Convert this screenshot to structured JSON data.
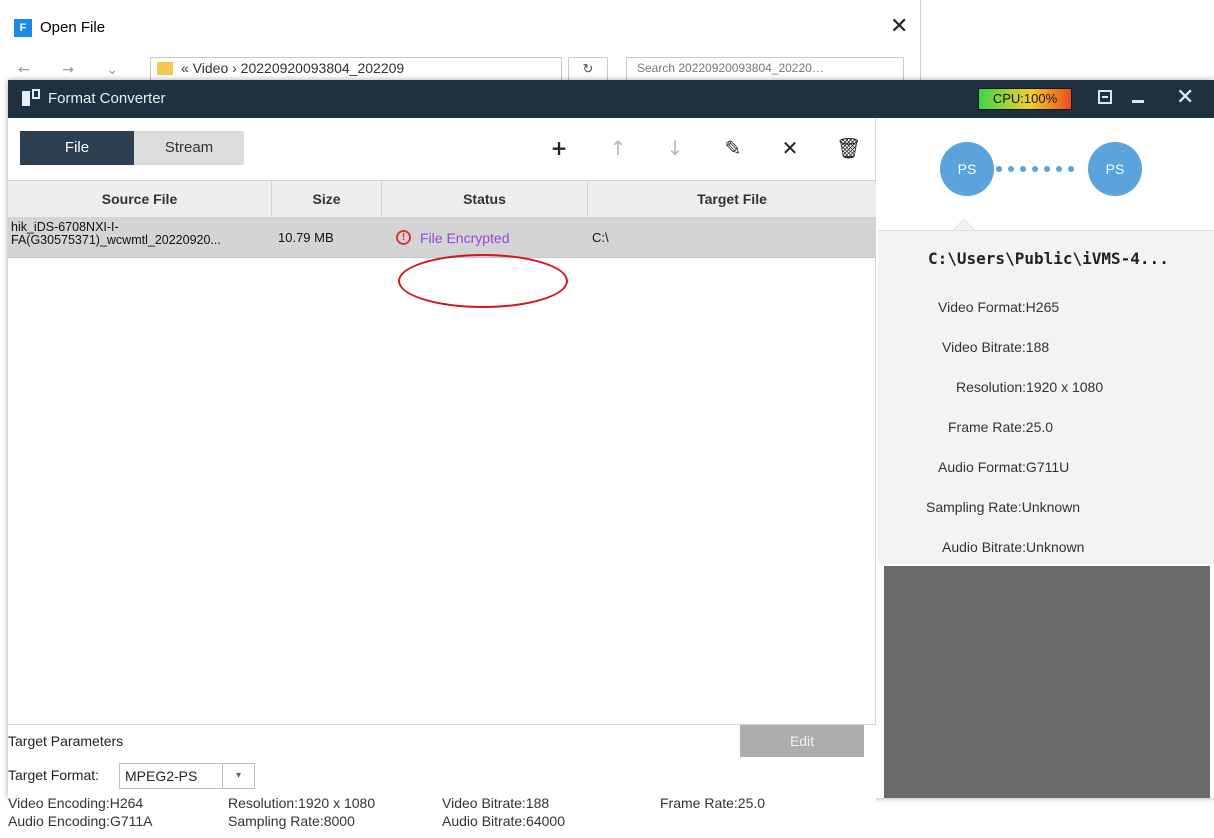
{
  "open_dialog": {
    "title": "Open File",
    "close_glyph": "✕",
    "nav_glyphs": "← → ⌄ ↑",
    "address": "« Video › 20220920093804_202209",
    "search_placeholder": "Search 20220920093804_20220…",
    "refresh_glyph": "↻"
  },
  "window": {
    "title": "Format Converter",
    "cpu_label": "CPU:100%",
    "close_glyph": "✕"
  },
  "tabs": {
    "file": "File",
    "stream": "Stream"
  },
  "toolbar": {
    "add_icon": "+",
    "up_icon": "↑",
    "down_icon": "↓",
    "edit_icon": "✎",
    "remove_icon": "✕",
    "delete_icon": "🗑"
  },
  "table": {
    "columns": [
      "Source File",
      "Size",
      "Status",
      "Target File"
    ],
    "rows": [
      {
        "source_line1": "hik_iDS-6708NXI-I-",
        "source_line2": "FA(G30575371)_wcwmtl_20220920...",
        "size": "10.79 MB",
        "status_icon": "!",
        "status": "File Encrypted",
        "target": "C:\\"
      }
    ]
  },
  "params": {
    "title": "Target Parameters",
    "edit_label": "Edit",
    "target_format_label": "Target Format:",
    "target_format_value": "MPEG2-PS",
    "caret": "▾",
    "video_encoding": "Video Encoding:H264",
    "resolution": "Resolution:1920 x 1080",
    "video_bitrate": "Video Bitrate:188",
    "frame_rate": "Frame Rate:25.0",
    "audio_encoding": "Audio Encoding:G711A",
    "sampling_rate": "Sampling Rate:8000",
    "audio_bitrate": "Audio Bitrate:64000"
  },
  "info": {
    "src_label": "PS",
    "dst_label": "PS",
    "path": "C:\\Users\\Public\\iVMS-4...",
    "video_format": "Video Format:H265",
    "video_bitrate": "Video Bitrate:188",
    "resolution": "Resolution:1920 x 1080",
    "frame_rate": "Frame Rate:25.0",
    "audio_format": "Audio Format:G711U",
    "sampling_rate": "Sampling Rate:Unknown",
    "audio_bitrate": "Audio Bitrate:Unknown"
  },
  "colors": {
    "titlebar": "#1f3040",
    "tab_active": "#2c3e50",
    "accent": "#5aa3dc",
    "status_text": "#9b47d8",
    "status_icon": "#e0303a",
    "annotation": "#d4151c"
  }
}
